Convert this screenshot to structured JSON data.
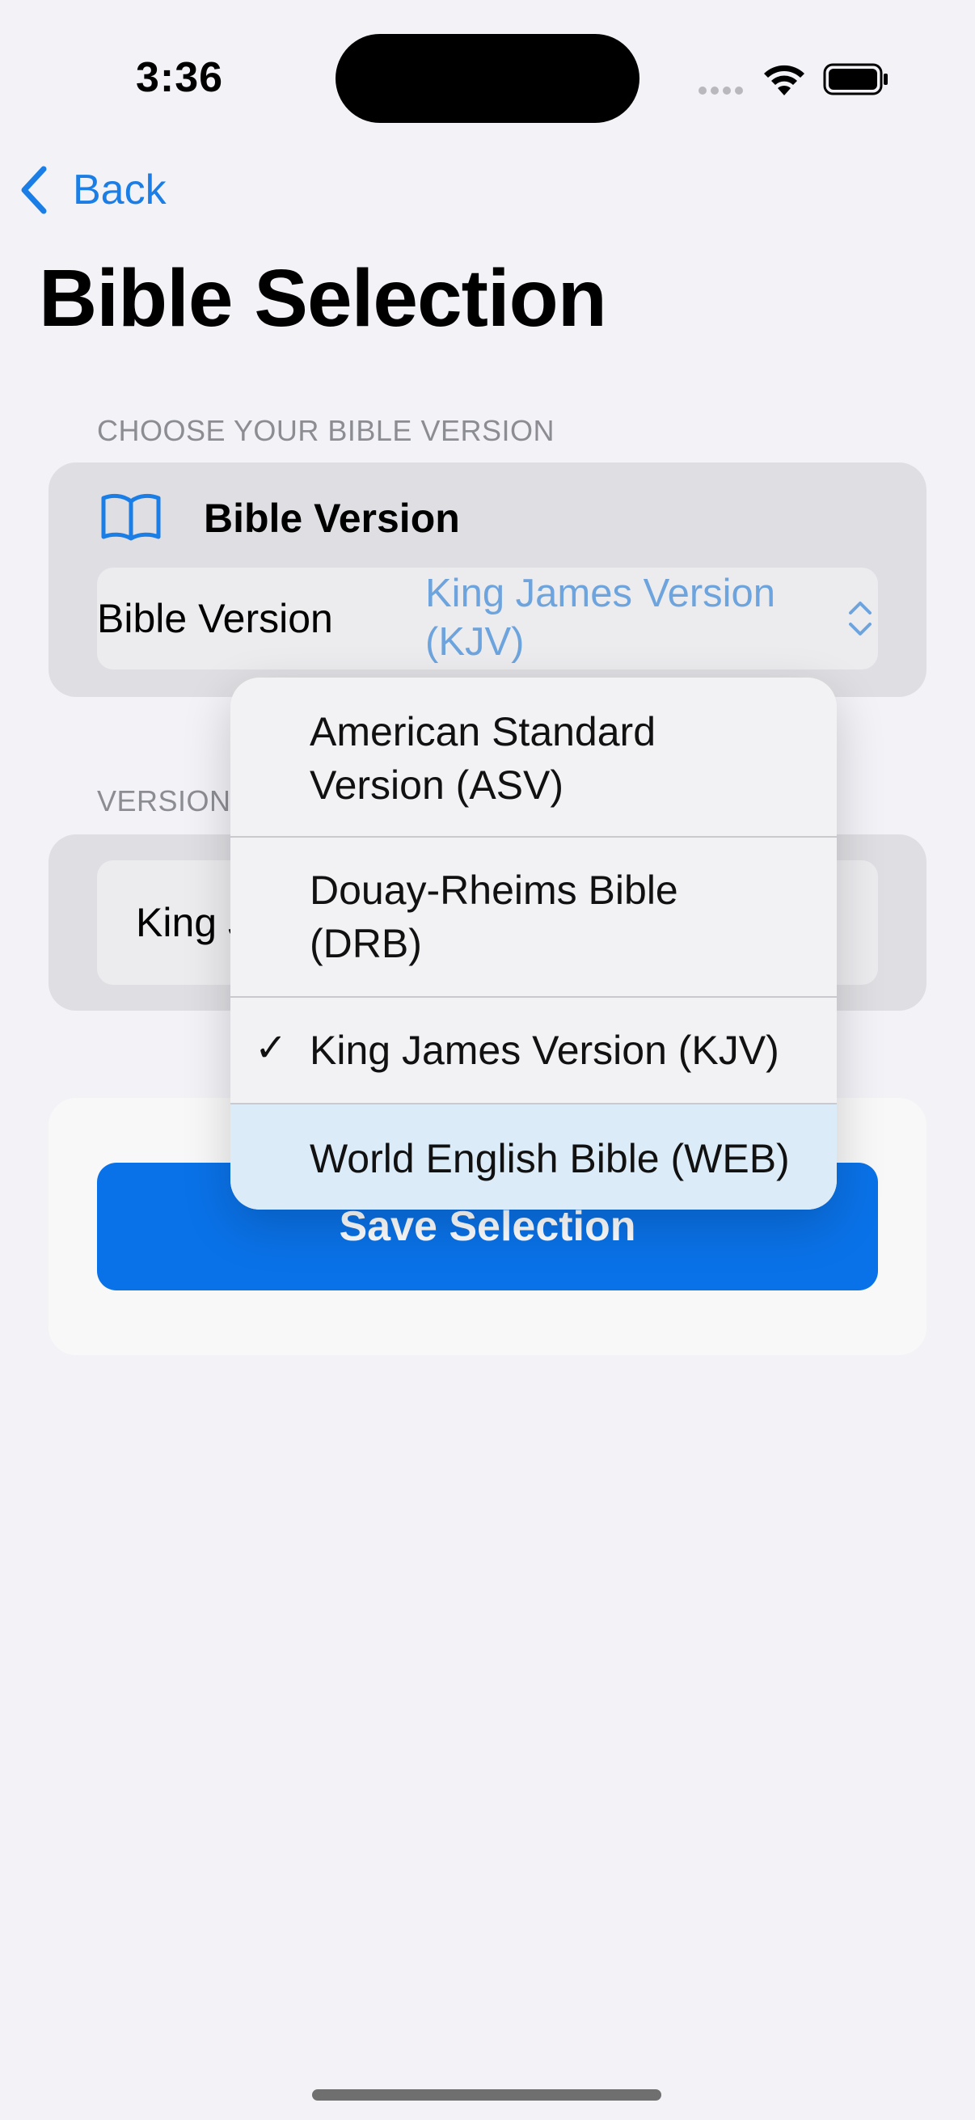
{
  "status_bar": {
    "time": "3:36"
  },
  "nav": {
    "back_label": "Back"
  },
  "page": {
    "title": "Bible Selection"
  },
  "section1": {
    "header": "CHOOSE YOUR BIBLE VERSION",
    "card_title": "Bible Version",
    "picker_label": "Bible Version",
    "picker_value": "King James Version (KJV)"
  },
  "section2": {
    "header": "VERSION",
    "value": "King J"
  },
  "save_button": {
    "label": "Save Selection"
  },
  "menu": {
    "items": [
      {
        "label": "American Standard Version (ASV)",
        "checked": false
      },
      {
        "label": "Douay-Rheims Bible (DRB)",
        "checked": false
      },
      {
        "label": "King James Version (KJV)",
        "checked": true
      },
      {
        "label": "World English Bible (WEB)",
        "checked": false
      }
    ],
    "check_glyph": "✓"
  },
  "colors": {
    "accent": "#0a72e8",
    "background": "#f2f2f7",
    "picker_value": "#6ea4dd"
  }
}
